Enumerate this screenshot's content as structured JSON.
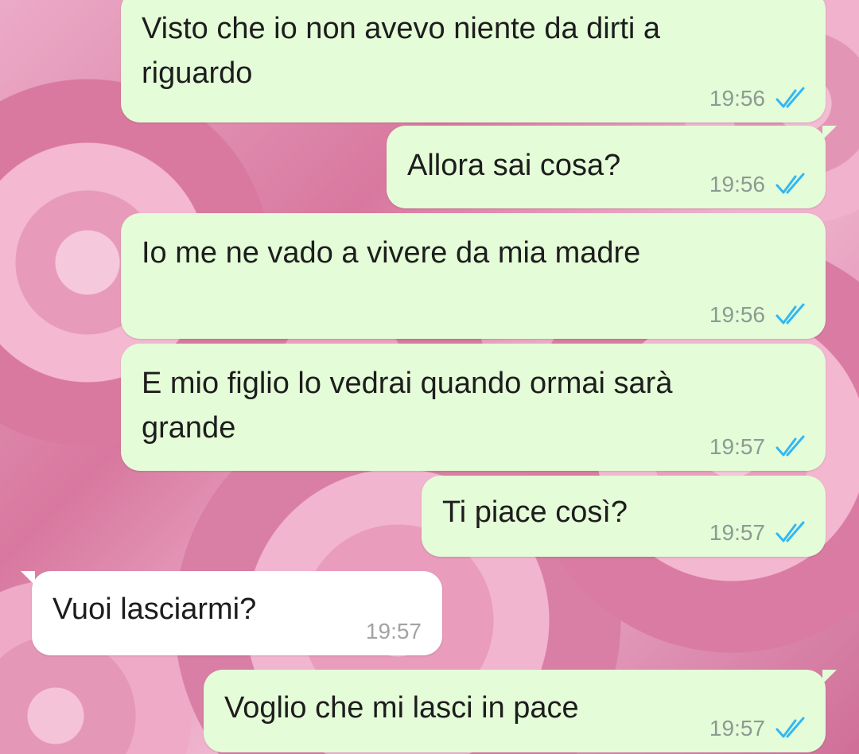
{
  "colors": {
    "outgoing_bubble": "#e4fcd8",
    "incoming_bubble": "#ffffff",
    "read_tick": "#34b7f1",
    "timestamp": "#8d9a92"
  },
  "messages": [
    {
      "text": "Visto che io non avevo niente da dirti a\nriguardo",
      "time": "19:56",
      "direction": "outgoing",
      "status": "read"
    },
    {
      "text": "Allora sai cosa?",
      "time": "19:56",
      "direction": "outgoing",
      "status": "read"
    },
    {
      "text": "Io me ne vado a vivere da mia madre",
      "time": "19:56",
      "direction": "outgoing",
      "status": "read"
    },
    {
      "text": "E mio figlio lo vedrai quando ormai sarà\ngrande",
      "time": "19:57",
      "direction": "outgoing",
      "status": "read"
    },
    {
      "text": "Ti piace così?",
      "time": "19:57",
      "direction": "outgoing",
      "status": "read"
    },
    {
      "text": "Vuoi lasciarmi?",
      "time": "19:57",
      "direction": "incoming",
      "status": ""
    },
    {
      "text": "Voglio che mi lasci in pace",
      "time": "19:57",
      "direction": "outgoing",
      "status": "read"
    }
  ],
  "icons": {
    "read_receipt": "double-check-icon"
  }
}
